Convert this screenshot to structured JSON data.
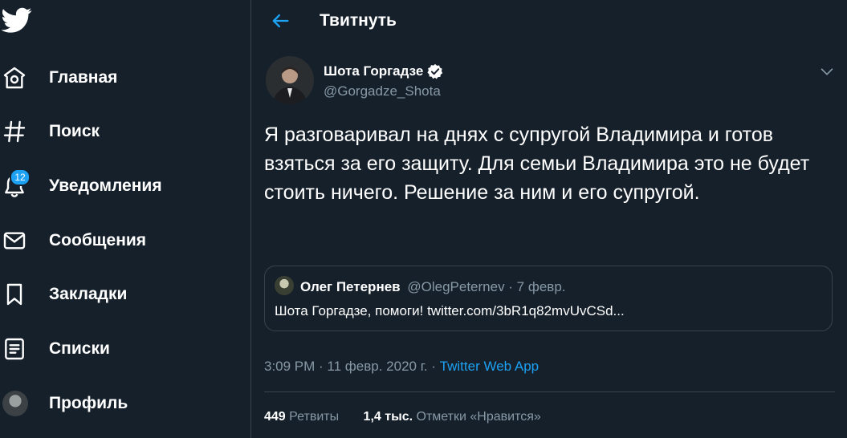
{
  "nav": {
    "items": [
      {
        "label": "Главная",
        "icon": "home-icon"
      },
      {
        "label": "Поиск",
        "icon": "explore-icon"
      },
      {
        "label": "Уведомления",
        "icon": "bell-icon",
        "badge": "12"
      },
      {
        "label": "Сообщения",
        "icon": "mail-icon"
      },
      {
        "label": "Закладки",
        "icon": "bookmark-icon"
      },
      {
        "label": "Списки",
        "icon": "list-icon"
      },
      {
        "label": "Профиль",
        "icon": "avatar"
      }
    ]
  },
  "header": {
    "title": "Твитнуть"
  },
  "tweet": {
    "author_name": "Шота Горгадзе",
    "author_handle": "@Gorgadze_Shota",
    "text": "Я разговаривал на днях с супругой Владимира и готов взяться за его защиту. Для семьи Владимира это не будет стоить ничего. Решение за ним и его супругой.",
    "quote": {
      "name": "Олег Петернев",
      "meta": "@OlegPeternev · 7 февр.",
      "text": "Шота Горгадзе, помоги! twitter.com/3bR1q82mvUvCSd..."
    },
    "time": "3:09 PM · 11 февр. 2020 г. · ",
    "source": "Twitter Web App",
    "retweets_count": "449",
    "retweets_label": "Ретвиты",
    "likes_count": "1,4 тыс.",
    "likes_label": "Отметки «Нравится»"
  },
  "colors": {
    "background": "#15202b",
    "accent": "#1da1f2",
    "muted": "#8899a6",
    "border": "#38444d"
  }
}
